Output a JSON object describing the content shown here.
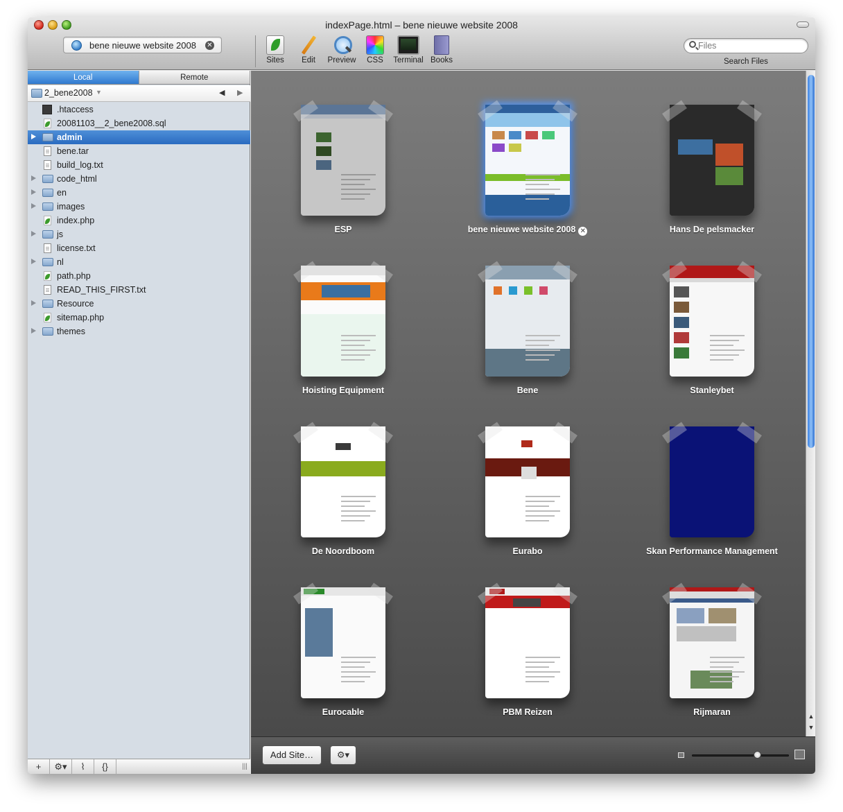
{
  "window": {
    "title": "indexPage.html – bene nieuwe website 2008"
  },
  "toolbar": {
    "site_field": "bene nieuwe website 2008",
    "tools": [
      {
        "label": "Sites",
        "icon": "sites-icon"
      },
      {
        "label": "Edit",
        "icon": "pencil-icon"
      },
      {
        "label": "Preview",
        "icon": "magnifier-icon"
      },
      {
        "label": "CSS",
        "icon": "color-wheel-icon"
      },
      {
        "label": "Terminal",
        "icon": "terminal-icon"
      },
      {
        "label": "Books",
        "icon": "book-icon"
      }
    ],
    "search": {
      "placeholder": "Files",
      "label": "Search Files"
    }
  },
  "sidebar": {
    "tabs": {
      "local": "Local",
      "remote": "Remote"
    },
    "path": "2_bene2008",
    "files": [
      {
        "name": ".htaccess",
        "type": "dark"
      },
      {
        "name": "20081103__2_bene2008.sql",
        "type": "leaf"
      },
      {
        "name": "admin",
        "type": "folder",
        "selected": true
      },
      {
        "name": "bene.tar",
        "type": "doc"
      },
      {
        "name": "build_log.txt",
        "type": "doc"
      },
      {
        "name": "code_html",
        "type": "folder"
      },
      {
        "name": "en",
        "type": "folder"
      },
      {
        "name": "images",
        "type": "folder"
      },
      {
        "name": "index.php",
        "type": "leaf"
      },
      {
        "name": "js",
        "type": "folder"
      },
      {
        "name": "license.txt",
        "type": "doc"
      },
      {
        "name": "nl",
        "type": "folder"
      },
      {
        "name": "path.php",
        "type": "leaf"
      },
      {
        "name": "READ_THIS_FIRST.txt",
        "type": "doc"
      },
      {
        "name": "Resource",
        "type": "folder"
      },
      {
        "name": "sitemap.php",
        "type": "leaf"
      },
      {
        "name": "themes",
        "type": "folder"
      }
    ],
    "bottom": {
      "add": "+",
      "action": "⚙▾",
      "rss": "⌇",
      "braces": "{}",
      "grip": "|||"
    }
  },
  "sites": [
    {
      "name": "ESP",
      "theme": "esp"
    },
    {
      "name": "bene nieuwe website 2008",
      "theme": "bene2008",
      "selected": true
    },
    {
      "name": "Hans De pelsmacker",
      "theme": "hans"
    },
    {
      "name": "Hoisting Equipment",
      "theme": "hoisting"
    },
    {
      "name": "Bene",
      "theme": "bene"
    },
    {
      "name": "Stanleybet",
      "theme": "stanley"
    },
    {
      "name": "De Noordboom",
      "theme": "noordboom"
    },
    {
      "name": "Eurabo",
      "theme": "eurabo"
    },
    {
      "name": "Skan Performance Management",
      "theme": "skan"
    },
    {
      "name": "Eurocable",
      "theme": "eurocable"
    },
    {
      "name": "PBM Reizen",
      "theme": "pbm"
    },
    {
      "name": "Rijmaran",
      "theme": "rijmaran"
    }
  ],
  "footer": {
    "add_site": "Add Site…",
    "gear": "⚙▾"
  },
  "zoom_level": 0.67
}
